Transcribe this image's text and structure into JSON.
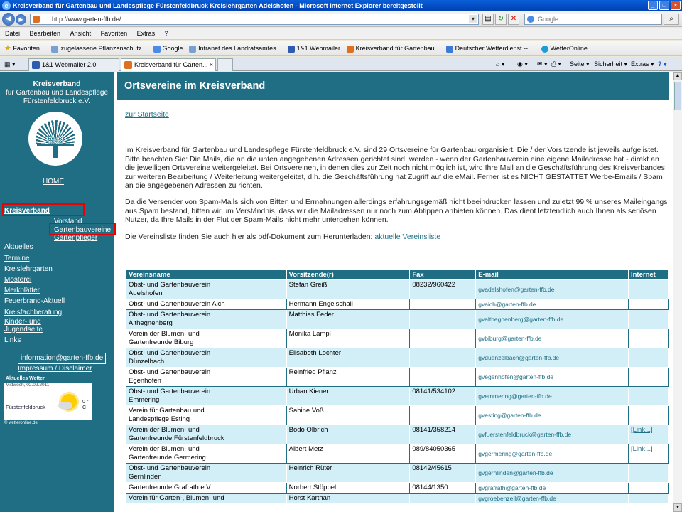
{
  "window": {
    "title": "Kreisverband für Gartenbau und Landespflege Fürstenfeldbruck Kreislehrgarten Adelshofen - Microsoft Internet Explorer bereitgestellt"
  },
  "address": {
    "url": "http://www.garten-ffb.de/",
    "search_placeholder": "Google"
  },
  "menu": [
    "Datei",
    "Bearbeiten",
    "Ansicht",
    "Favoriten",
    "Extras",
    "?"
  ],
  "favorites": {
    "label": "Favoriten",
    "items": [
      "zugelassene Pflanzenschutz...",
      "Google",
      "Intranet des Landratsamtes...",
      "1&1 Webmailer",
      "Kreisverband für Gartenbau...",
      "Deutscher Wetterdienst -- ...",
      "WetterOnline"
    ]
  },
  "tabs": [
    "1&1 Webmailer 2.0",
    "Kreisverband für Garten..."
  ],
  "tools": {
    "seite": "Seite ▾",
    "sicherheit": "Sicherheit ▾",
    "extras": "Extras ▾"
  },
  "sidebar": {
    "org_line1": "Kreisverband",
    "org_line2": "für Gartenbau und Landespflege",
    "org_line3": "Fürstenfeldbruck e.V.",
    "home": "HOME",
    "nav": {
      "kreisverband": "Kreisverband",
      "vorstand": "Vorstand",
      "gartenbauvereine": "Gartenbauvereine",
      "gartenpfleger": "Gartenpfleger",
      "aktuelles": "Aktuelles",
      "termine": "Termine",
      "kreislehrgarten": "Kreislehrgarten",
      "mosterei": "Mosterei",
      "merkblaetter": "Merkblätter",
      "feuerbrand": "Feuerbrand-Aktuell",
      "kreisfachberatung": "Kreisfachberatung",
      "kinder1": "Kinder- und",
      "kinder2": "Jugendseite",
      "links": "Links"
    },
    "email": "information@garten-ffb.de",
    "impressum": "Impressum / Disclaimer",
    "weather": {
      "title": "Aktuelles Wetter",
      "date": "Mittwoch, 02.02.2011",
      "city": "Fürstenfeldbruck",
      "temp": "0 °",
      "unit": "C",
      "credit": "© wetteronline.de"
    }
  },
  "main": {
    "heading": "Ortsvereine im Kreisverband",
    "start_link": "zur Startseite",
    "para1": "Im Kreisverband für Gartenbau und Landespflege Fürstenfeldbruck e.V. sind 29 Ortsvereine für Gartenbau organisiert. Die / der Vorsitzende ist jeweils aufgelistet.",
    "para2": "Bitte beachten Sie: Die Mails, die an die unten angegebenen Adressen gerichtet sind, werden - wenn der Gartenbauverein eine eigene Mailadresse hat - direkt an die jeweiligen Ortsvereine weitergeleitet. Bei Ortsvereinen, in denen dies zur Zeit noch nicht möglich ist, wird Ihre Mail an die Geschäftsführung des Kreisverbandes zur weiteren Bearbeitung / Weiterleitung weitergeleitet, d.h. die Geschäftsführung hat Zugriff auf die eMail. Ferner ist es NICHT GESTATTET Werbe-Emails / Spam an die angegebenen Adressen zu richten.",
    "para3": "Da die Versender von Spam-Mails sich von Bitten und Ermahnungen allerdings erfahrungsgemäß nicht beeindrucken lassen und zuletzt 99 % unseres Maileingangs aus Spam bestand, bitten wir um Verständnis, dass wir die Mailadressen nur noch zum Abtippen anbieten können. Das dient letztendlich auch Ihnen als seriösen Nutzer, da Ihre Mails in der Flut der Spam-Mails nicht mehr untergehen können.",
    "pdf_text": "Die Vereinsliste finden Sie auch hier als pdf-Dokument zum Herunterladen:",
    "pdf_link": "aktuelle Vereinsliste"
  },
  "table": {
    "headers": [
      "Vereinsname",
      "Vorsitzende(r)",
      "Fax",
      "E-mail",
      "Internet"
    ],
    "rows": [
      {
        "l1": "Obst- und Gartenbauverein",
        "l2": "Adelshofen",
        "chair": "Stefan Greißl",
        "fax": "08232/960422",
        "mail": "gvadelshofen@garten-ffb.de",
        "web": ""
      },
      {
        "l1": "Obst- und Gartenbauverein Aich",
        "l2": "",
        "chair": "Hermann Engelschall",
        "fax": "",
        "mail": "gvaich@garten-ffb.de",
        "web": ""
      },
      {
        "l1": "Obst- und Gartenbauverein",
        "l2": "Althegnenberg",
        "chair": "Matthias Feder",
        "fax": "",
        "mail": "gvalthegnenberg@garten-ffb.de",
        "web": ""
      },
      {
        "l1": "Verein der Blumen- und",
        "l2": "Gartenfreunde Biburg",
        "chair": "Monika Lampl",
        "fax": "",
        "mail": "gvbiburg@garten-ffb.de",
        "web": ""
      },
      {
        "l1": "Obst- und Gartenbauverein",
        "l2": "Dünzelbach",
        "chair": "Elisabeth Lochter",
        "fax": "",
        "mail": "gvduenzelbach@garten-ffb.de",
        "web": ""
      },
      {
        "l1": "Obst- und Gartenbauverein",
        "l2": "Egenhofen",
        "chair": "Reinfried Pflanz",
        "fax": "",
        "mail": "gvegenhofen@garten-ffb.de",
        "web": ""
      },
      {
        "l1": "Obst- und Gartenbauverein",
        "l2": "Emmering",
        "chair": "Urban Kiener",
        "fax": "08141/534102",
        "mail": "gvemmering@garten-ffb.de",
        "web": ""
      },
      {
        "l1": "Verein für Gartenbau und",
        "l2": "Landespflege Esting",
        "chair": "Sabine Voß",
        "fax": "",
        "mail": "gvesting@garten-ffb.de",
        "web": ""
      },
      {
        "l1": "Verein der Blumen- und",
        "l2": "Gartenfreunde Fürstenfeldbruck",
        "chair": "Bodo Olbrich",
        "fax": "08141/358214",
        "mail": "gvfuerstenfeldbruck@garten-ffb.de",
        "web": "[Link...]"
      },
      {
        "l1": "Verein der Blumen- und",
        "l2": "Gartenfreunde Germering",
        "chair": "Albert Metz",
        "fax": "089/84050365",
        "mail": "gvgermering@garten-ffb.de",
        "web": "[Link...]"
      },
      {
        "l1": "Obst- und Gartenbauverein",
        "l2": "Gernlinden",
        "chair": "Heinrich Rüter",
        "fax": "08142/45615",
        "mail": "gvgernlinden@garten-ffb.de",
        "web": ""
      },
      {
        "l1": "Gartenfreunde Grafrath e.V.",
        "l2": "",
        "chair": "Norbert Stöppel",
        "fax": "08144/1350",
        "mail": "gvgrafrath@garten-ffb.de",
        "web": ""
      },
      {
        "l1": "Verein für Garten-, Blumen- und",
        "l2": "",
        "chair": "Horst Karthan",
        "fax": "",
        "mail": "gvgroebenzell@garten-ffb.de",
        "web": ""
      }
    ]
  }
}
